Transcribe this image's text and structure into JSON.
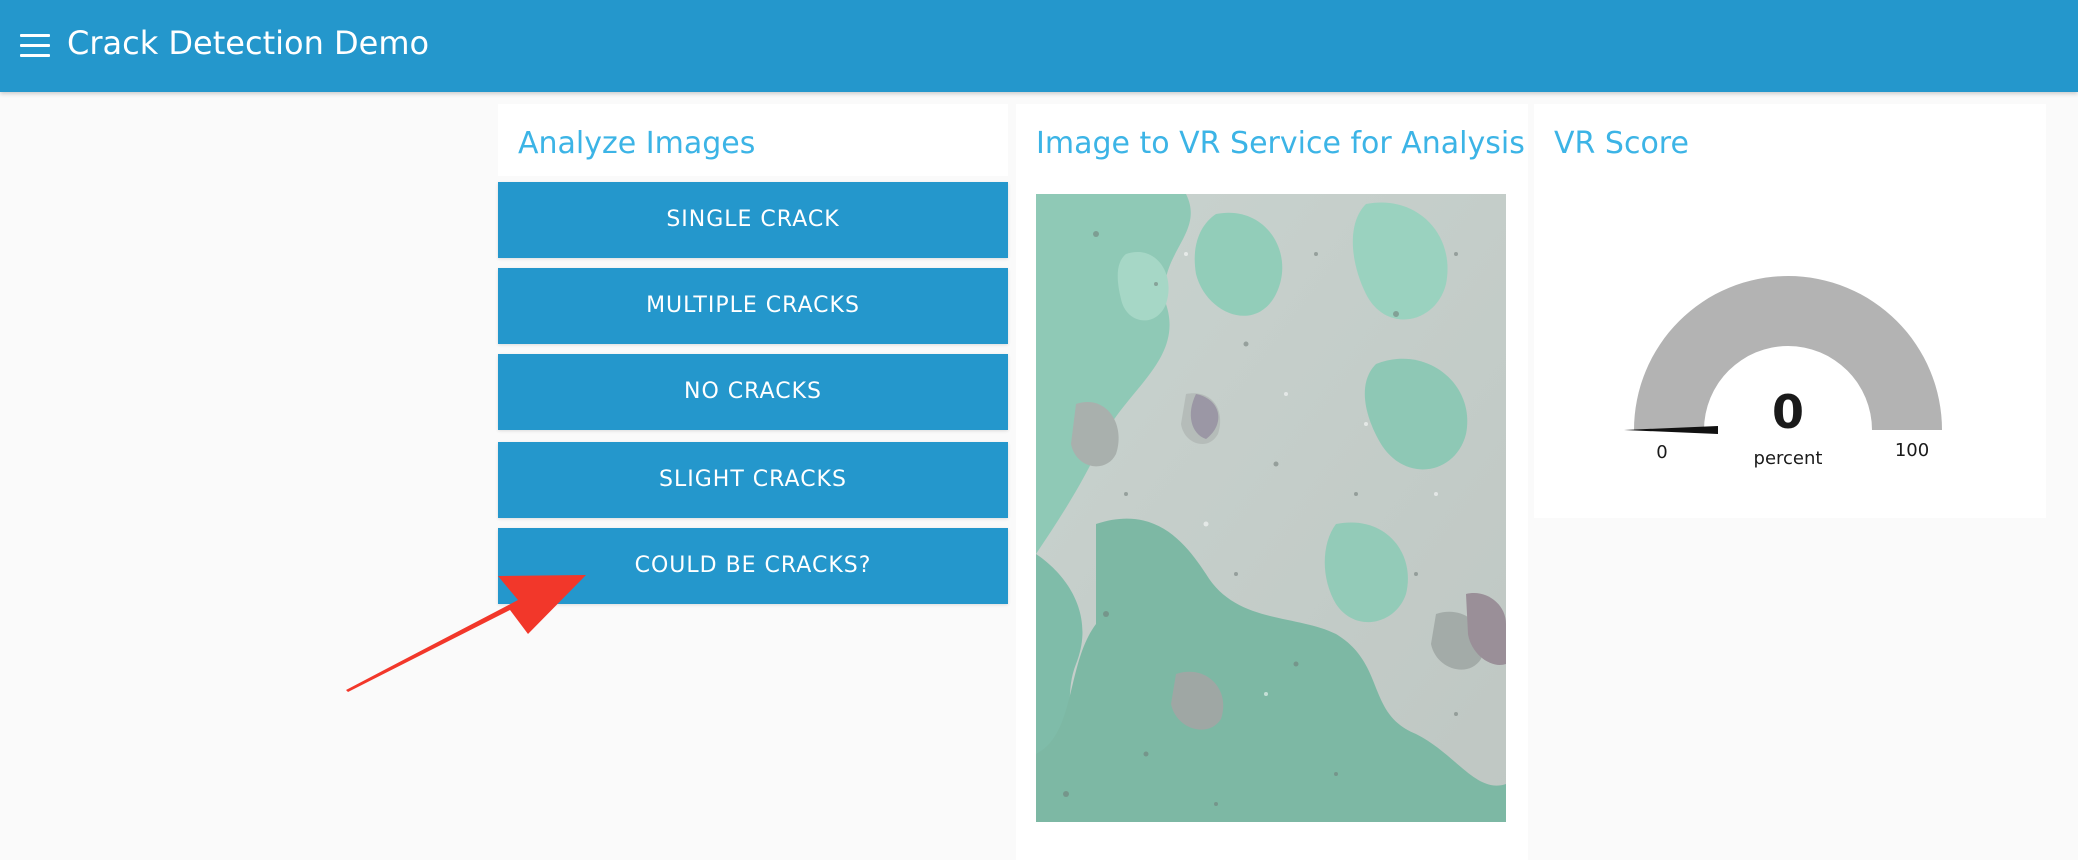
{
  "header": {
    "title": "Crack Detection Demo",
    "menu_icon": "hamburger-menu-icon",
    "background": "#2497cc"
  },
  "analyze": {
    "title": "Analyze Images",
    "buttons": [
      {
        "label": "SINGLE CRACK"
      },
      {
        "label": "MULTIPLE CRACKS"
      },
      {
        "label": "NO CRACKS"
      },
      {
        "label": "SLIGHT CRACKS"
      },
      {
        "label": "COULD BE CRACKS?"
      }
    ],
    "annotation": "red-arrow-icon"
  },
  "image_panel": {
    "title": "Image to VR Service for Analysis",
    "image": "peeling-paint-surface"
  },
  "score": {
    "title": "VR Score",
    "gauge": {
      "value": 0,
      "value_text": "0",
      "unit": "percent",
      "min_label": "0",
      "max_label": "100",
      "track_color": "#b3b3b3",
      "needle_color": "#111111"
    }
  },
  "colors": {
    "accent": "#2497cc",
    "title_text": "#3cb4e6",
    "annotation_red": "#f2372a"
  }
}
